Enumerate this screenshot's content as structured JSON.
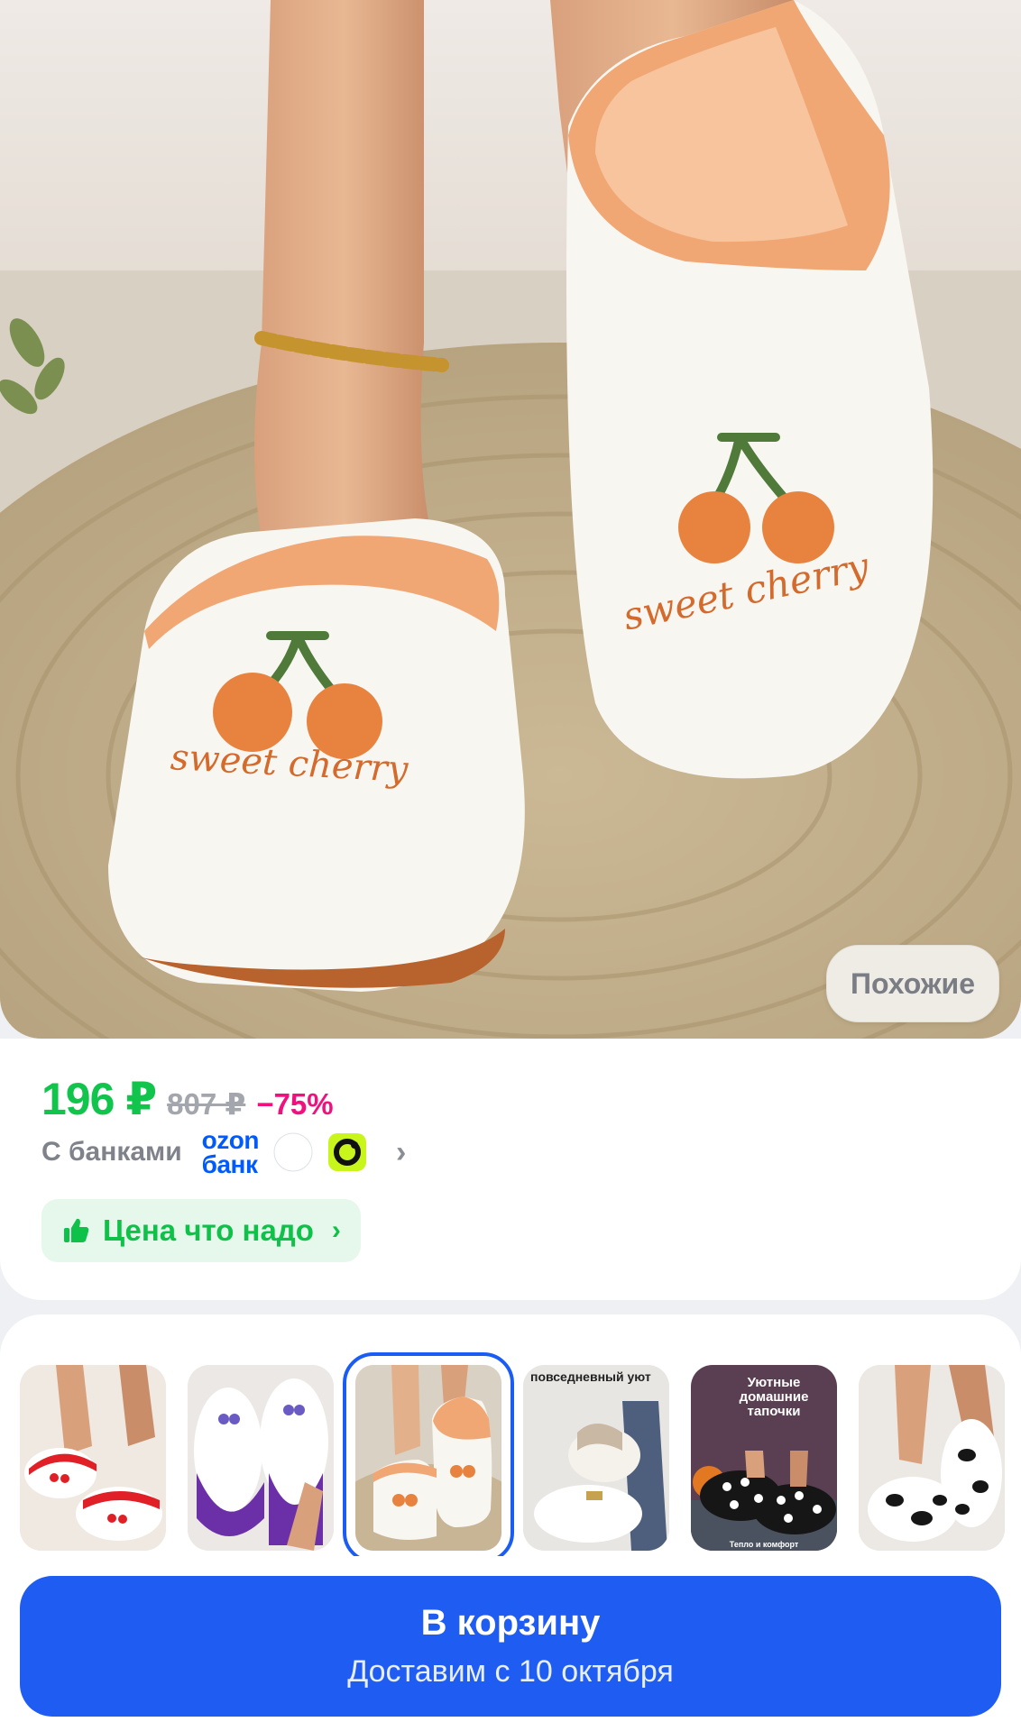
{
  "hero": {
    "similar_button": "Похожие",
    "embroidery_text": "sweet cherry",
    "colors": {
      "slipper": "#f8f6f1",
      "trim": "#f0a774",
      "cherry": "#e8833f",
      "stem": "#4f7a3a",
      "rug": "#c9b796"
    }
  },
  "price": {
    "current": "196 ₽",
    "old": "807 ₽",
    "discount": "−75%",
    "banks_label": "С банками",
    "ozon_bank_line1": "ozon",
    "ozon_bank_line2": "банк",
    "good_price_label": "Цена что надо",
    "colors": {
      "price": "#10c44c",
      "discount": "#f1117e",
      "ozon": "#005bff"
    }
  },
  "thumbnails": [
    {
      "name": "thumb-red-white",
      "caption": ""
    },
    {
      "name": "thumb-purple-white",
      "caption": ""
    },
    {
      "name": "thumb-orange-cherry",
      "caption": ""
    },
    {
      "name": "thumb-fluffy-white",
      "caption": "повседневный уют"
    },
    {
      "name": "thumb-polka-dot",
      "caption": "Уютные домашние тапочки",
      "footer": "Тепло и комфорт"
    },
    {
      "name": "thumb-cow-print",
      "caption": ""
    }
  ],
  "cart": {
    "title": "В корзину",
    "subtitle": "Доставим с 10 октября",
    "color": "#1f5cf2"
  }
}
